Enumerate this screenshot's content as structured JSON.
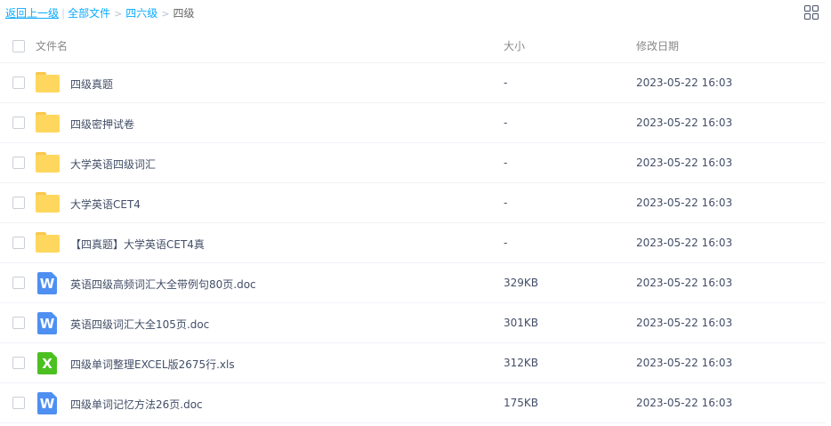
{
  "breadcrumb": {
    "back": "返回上一级",
    "separator": "|",
    "items": [
      "全部文件",
      "四六级"
    ],
    "chevron": ">",
    "current": "四级"
  },
  "header": {
    "name": "文件名",
    "size": "大小",
    "date": "修改日期"
  },
  "files": [
    {
      "name": "四级真题",
      "type": "folder-icon",
      "size": "-",
      "date": "2023-05-22 16:03"
    },
    {
      "name": "四级密押试卷",
      "type": "folder-icon",
      "size": "-",
      "date": "2023-05-22 16:03"
    },
    {
      "name": "大学英语四级词汇",
      "type": "folder-icon",
      "size": "-",
      "date": "2023-05-22 16:03"
    },
    {
      "name": "大学英语CET4",
      "type": "folder-icon",
      "size": "-",
      "date": "2023-05-22 16:03"
    },
    {
      "name": "【四真题】大学英语CET4真",
      "type": "folder-icon",
      "size": "-",
      "date": "2023-05-22 16:03"
    },
    {
      "name": "英语四级高频词汇大全带例句80页.doc",
      "type": "word-icon",
      "glyph": "W",
      "size": "329KB",
      "date": "2023-05-22 16:03"
    },
    {
      "name": "英语四级词汇大全105页.doc",
      "type": "word-icon",
      "glyph": "W",
      "size": "301KB",
      "date": "2023-05-22 16:03"
    },
    {
      "name": "四级单词整理EXCEL版2675行.xls",
      "type": "excel-icon",
      "glyph": "X",
      "size": "312KB",
      "date": "2023-05-22 16:03"
    },
    {
      "name": "四级单词记忆方法26页.doc",
      "type": "word-icon",
      "glyph": "W",
      "size": "175KB",
      "date": "2023-05-22 16:03"
    }
  ],
  "colors": {
    "link": "#09aaff",
    "folder": "#ffd75e",
    "word": "#4e8ff2",
    "excel": "#4bc020"
  }
}
